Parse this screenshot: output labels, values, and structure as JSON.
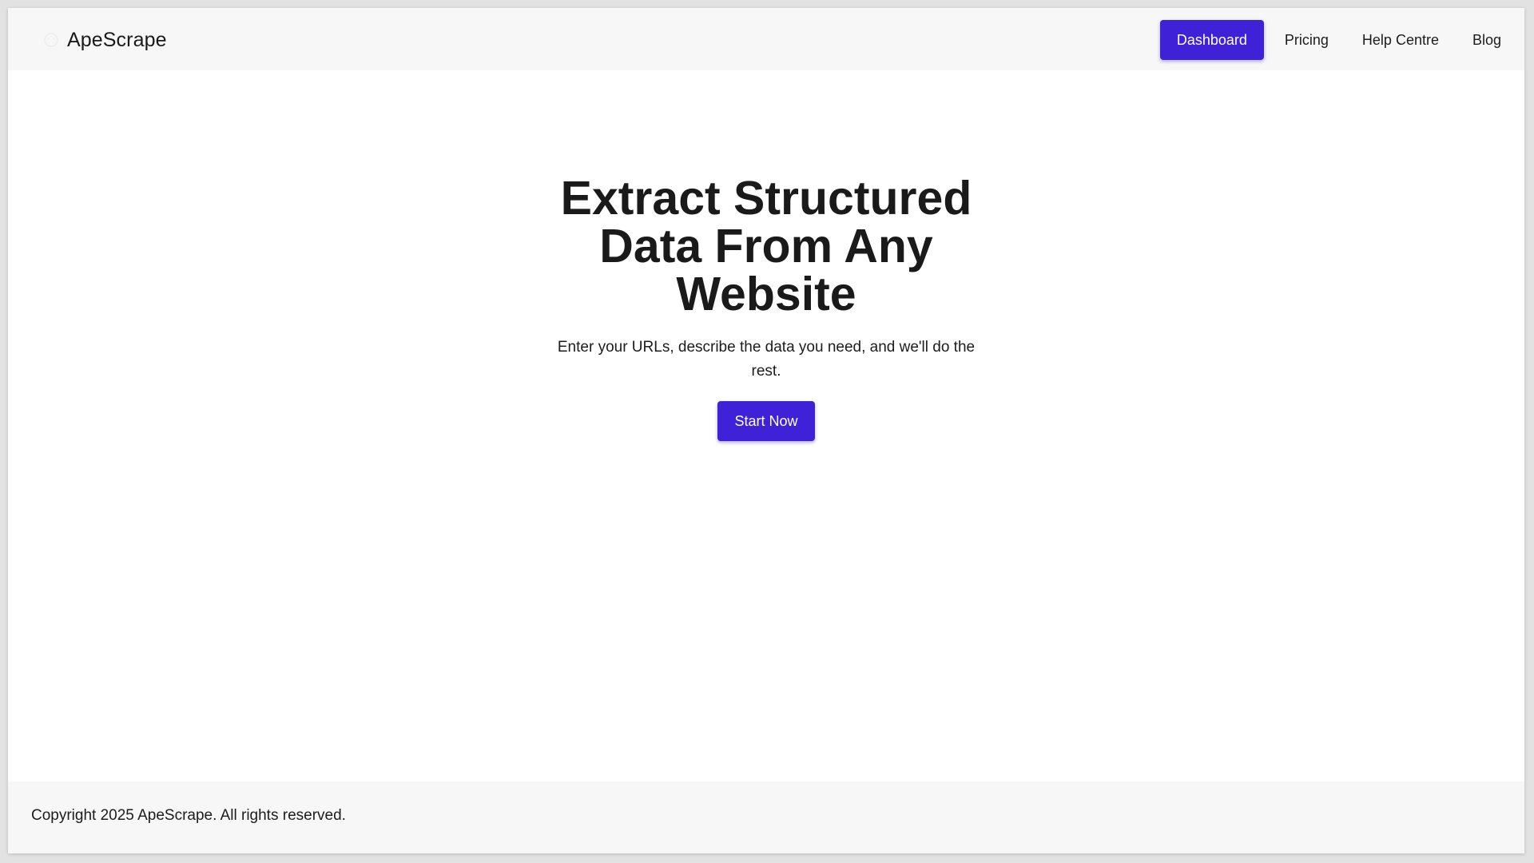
{
  "header": {
    "brand_icon": "ape-logo-icon",
    "brand_name": "ApeScrape",
    "nav": {
      "dashboard": "Dashboard",
      "pricing": "Pricing",
      "help": "Help Centre",
      "blog": "Blog"
    }
  },
  "hero": {
    "title": "Extract Structured Data From Any Website",
    "subtitle": "Enter your URLs, describe the data you need, and we'll do the rest.",
    "cta_label": "Start Now"
  },
  "footer": {
    "copyright": "Copyright 2025 ApeScrape. All rights reserved."
  },
  "colors": {
    "accent": "#3f22d8",
    "header_bg": "#f7f7f7",
    "footer_bg": "#f7f7f7",
    "text": "#1c1c1c"
  }
}
